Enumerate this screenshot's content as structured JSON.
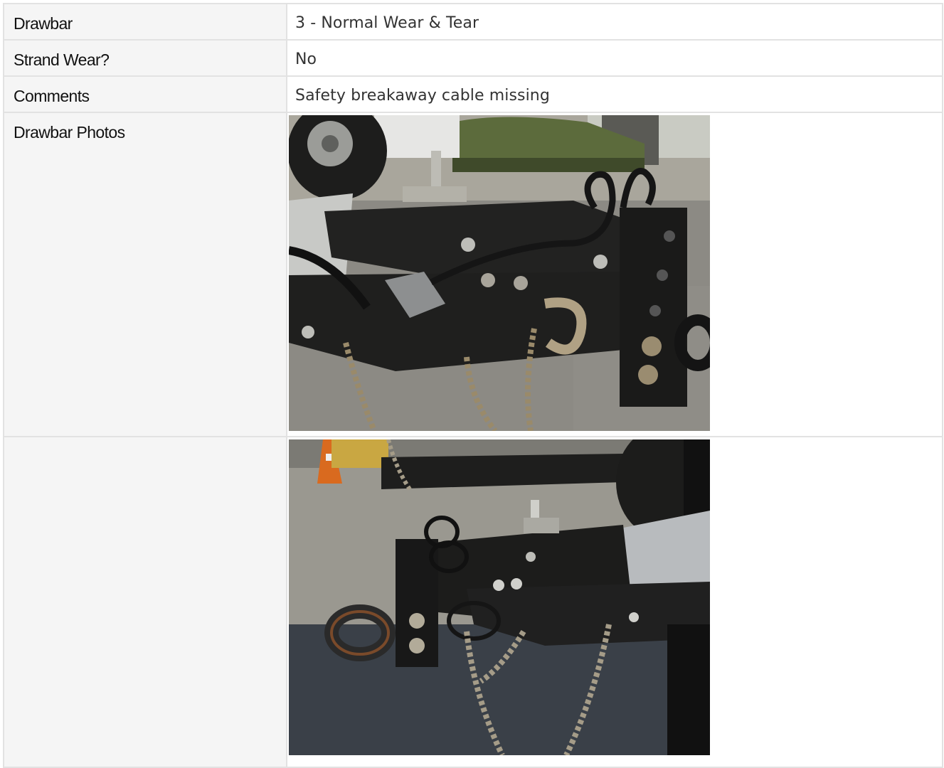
{
  "rows": [
    {
      "label": "Drawbar",
      "value": "3 - Normal Wear & Tear"
    },
    {
      "label": "Strand Wear?",
      "value": "No"
    },
    {
      "label": "Comments",
      "value": "Safety breakaway cable missing"
    }
  ],
  "photos": {
    "label": "Drawbar Photos",
    "second_label": "",
    "items": [
      {
        "alt": "drawbar-photo-side-view"
      },
      {
        "alt": "drawbar-photo-front-view"
      }
    ]
  },
  "colors": {
    "label_bg": "#f5f5f5",
    "border": "#e2e2e2",
    "value_text": "#333333",
    "label_text": "#111111"
  }
}
